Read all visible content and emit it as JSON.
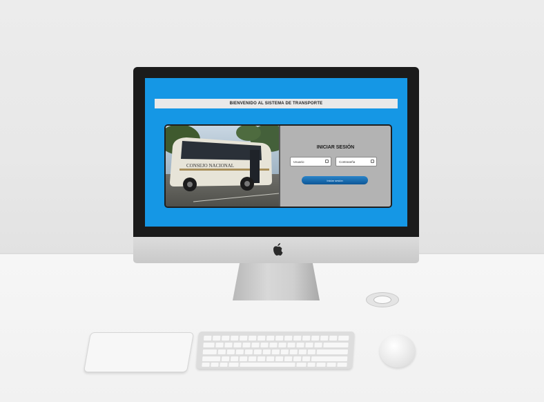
{
  "screen": {
    "title": "BIENVENIDO AL SISTEMA DE TRANSPORTE",
    "login": {
      "heading": "INICIAR SESIÓN",
      "username_placeholder": "Usuario",
      "password_placeholder": "Contraseña",
      "submit_label": "Iniciar sesión"
    },
    "photo": {
      "bus_text": "CONSEJO NACIONAL"
    },
    "colors": {
      "background": "#1597e5",
      "panel": "#b3b3b3",
      "button": "#0d5797"
    }
  },
  "hardware": {
    "logo_icon": "apple-logo-icon"
  }
}
